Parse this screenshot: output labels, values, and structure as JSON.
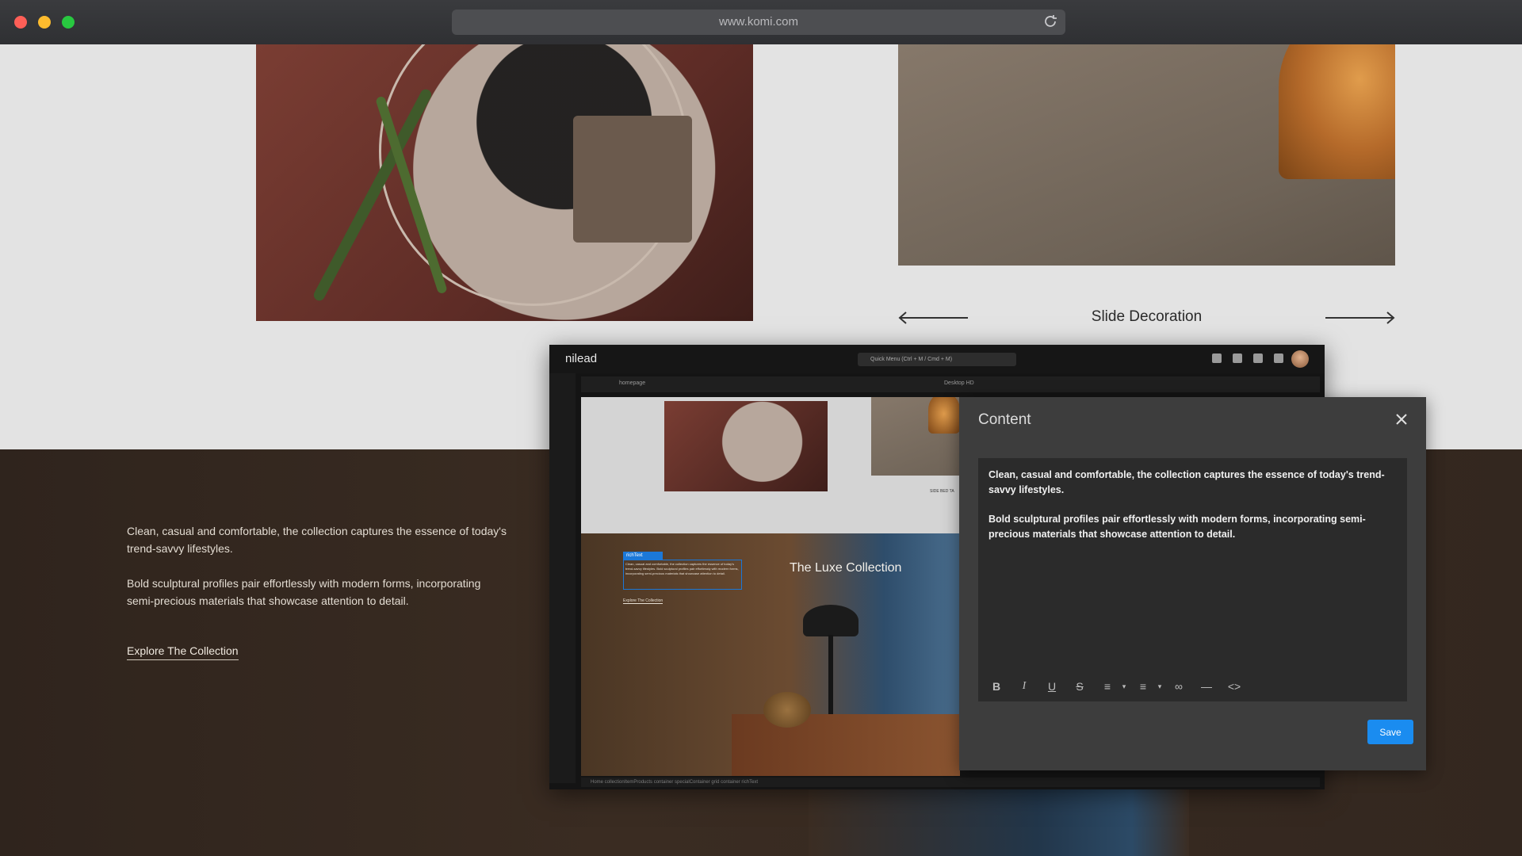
{
  "browser": {
    "url": "www.komi.com",
    "traffic_lights": {
      "close": "#fe5f57",
      "minimize": "#febc2e",
      "maximize": "#28c840"
    }
  },
  "slider": {
    "title": "Slide Decoration",
    "prev_icon": "arrow-left-icon",
    "next_icon": "arrow-right-icon"
  },
  "collection": {
    "paragraph_1": "Clean, casual and comfortable, the collection captures the essence of today's trend-savvy lifestyles.",
    "paragraph_2": "Bold sculptural profiles pair effortlessly with modern forms, incorporating semi-precious materials that showcase attention to detail.",
    "link": "Explore The Collection"
  },
  "editor": {
    "logo": "nilead",
    "search_placeholder": "Quick Menu (Ctrl + M / Cmd + M)",
    "page_field": "homepage",
    "device_label": "Desktop HD",
    "canvas": {
      "heading": "The Luxe Collection",
      "tag": "richText",
      "mini_text": "Clean, casual and comfortable, the collection captures the essence of today's trend-savvy lifestyles. Bold sculptural profiles pair effortlessly with modern forms, incorporating semi-precious materials that showcase attention to detail.",
      "mini_link": "Explore The Collection",
      "mini_caption": "SIDE BED TA"
    },
    "breadcrumb": "Home   collectionItemProducts   container   specialContainer   grid   container   richText"
  },
  "content_modal": {
    "title": "Content",
    "paragraph_1": "Clean, casual and comfortable, the collection captures the essence of today's trend-savvy lifestyles.",
    "paragraph_2": "Bold sculptural profiles pair effortlessly with modern forms, incorporating semi-precious materials that showcase attention to detail.",
    "save_label": "Save",
    "toolbar": [
      "bold-icon",
      "italic-icon",
      "underline-icon",
      "strikethrough-icon",
      "ordered-list-icon",
      "unordered-list-icon",
      "link-icon",
      "horizontal-rule-icon",
      "code-view-icon"
    ],
    "accent": "#1a8cf0"
  }
}
